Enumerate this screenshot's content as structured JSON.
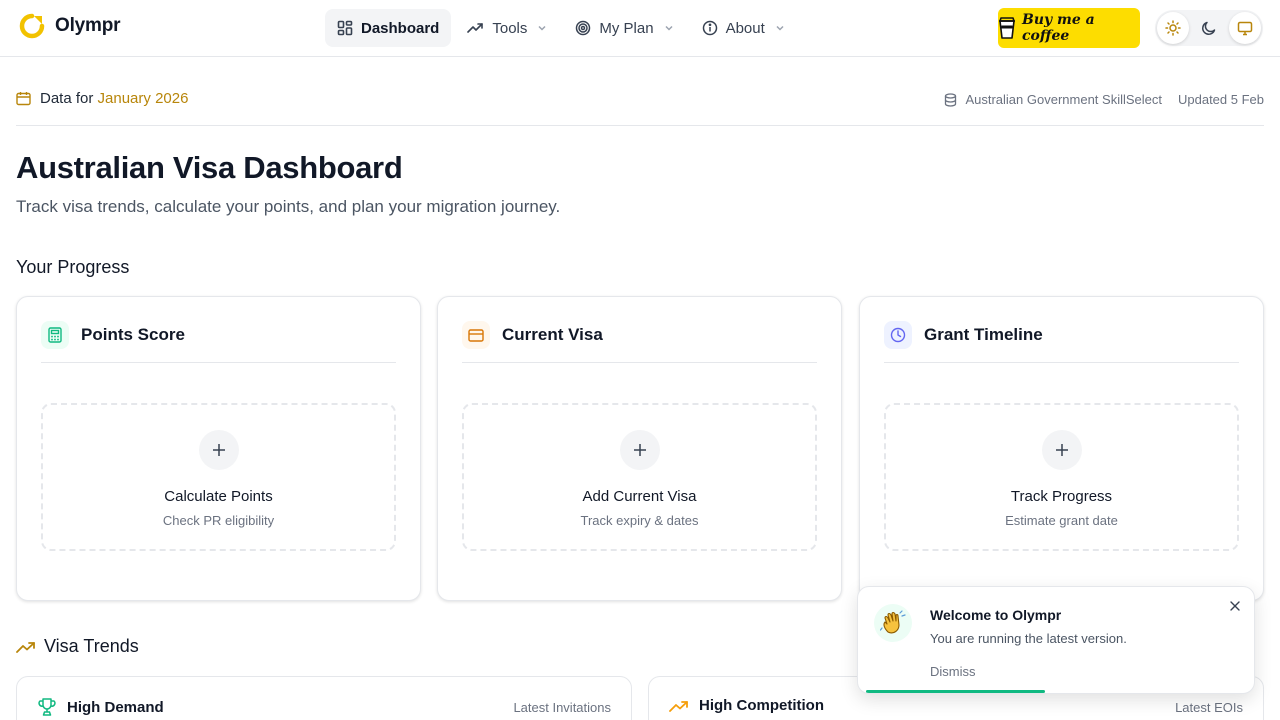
{
  "app": {
    "name": "Olympr",
    "logo_color": "#f2c200"
  },
  "nav": {
    "items": [
      {
        "label": "Dashboard",
        "icon": "dashboard-grid-icon",
        "active": true
      },
      {
        "label": "Tools",
        "icon": "trending-up-icon",
        "dropdown": true
      },
      {
        "label": "My Plan",
        "icon": "target-icon",
        "dropdown": true
      },
      {
        "label": "About",
        "icon": "info-icon",
        "dropdown": true
      }
    ],
    "coffee_label": "Buy me a coffee",
    "theme": [
      "light-mode-icon",
      "dark-mode-icon",
      "system-mode-icon"
    ]
  },
  "databar": {
    "prefix": "Data for",
    "month": "January 2026",
    "source": "Australian Government SkillSelect",
    "updated": "Updated 5 Feb"
  },
  "header": {
    "title": "Australian Visa Dashboard",
    "subtitle": "Track visa trends, calculate your points, and plan your migration journey."
  },
  "progress": {
    "title": "Your Progress",
    "cards": [
      {
        "title": "Points Score",
        "icon": "calculator-icon",
        "icon_color": "#10b981",
        "icon_bg": "#ecfdf5",
        "action": "Calculate Points",
        "hint": "Check PR eligibility"
      },
      {
        "title": "Current Visa",
        "icon": "credit-card-icon",
        "icon_color": "#d97706",
        "icon_bg": "#fff7ed",
        "action": "Add Current Visa",
        "hint": "Track expiry & dates"
      },
      {
        "title": "Grant Timeline",
        "icon": "clock-icon",
        "icon_color": "#6366f1",
        "icon_bg": "#eef2ff",
        "action": "Track Progress",
        "hint": "Estimate grant date"
      }
    ]
  },
  "trends": {
    "title": "Visa Trends",
    "cards": [
      {
        "title": "High Demand",
        "icon": "trophy-icon",
        "meta": "Latest Invitations"
      },
      {
        "title": "High Competition",
        "icon": "trending-up-icon",
        "meta": "Latest EOIs"
      }
    ]
  },
  "toast": {
    "emoji": "waving-hand-icon",
    "title": "Welcome to Olympr",
    "message": "You are running the latest version.",
    "dismiss": "Dismiss",
    "progress": 0.47,
    "accent": "#10b981"
  }
}
